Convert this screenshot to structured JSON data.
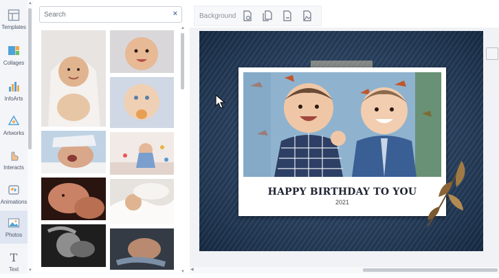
{
  "sidebar": {
    "items": [
      {
        "label": "Templates",
        "icon": "templates-icon"
      },
      {
        "label": "Collages",
        "icon": "collages-icon"
      },
      {
        "label": "InfoArts",
        "icon": "infoarts-icon"
      },
      {
        "label": "Artworks",
        "icon": "artworks-icon"
      },
      {
        "label": "Interacts",
        "icon": "interacts-icon"
      },
      {
        "label": "Animations",
        "icon": "animations-icon"
      },
      {
        "label": "Photos",
        "icon": "photos-icon",
        "active": true
      },
      {
        "label": "Text",
        "icon": "text-icon"
      }
    ]
  },
  "search": {
    "placeholder": "Search",
    "value": "",
    "clear_glyph": "×"
  },
  "toolbar": {
    "background_label": "Background"
  },
  "card": {
    "title": "HAPPY BIRTHDAY TO YOU",
    "year": "2021"
  },
  "colors": {
    "accent": "#5e7aa6",
    "rail_bg": "#f4f5f8",
    "active_item_bg": "#dfe6f2",
    "denim": "#1f3550"
  }
}
